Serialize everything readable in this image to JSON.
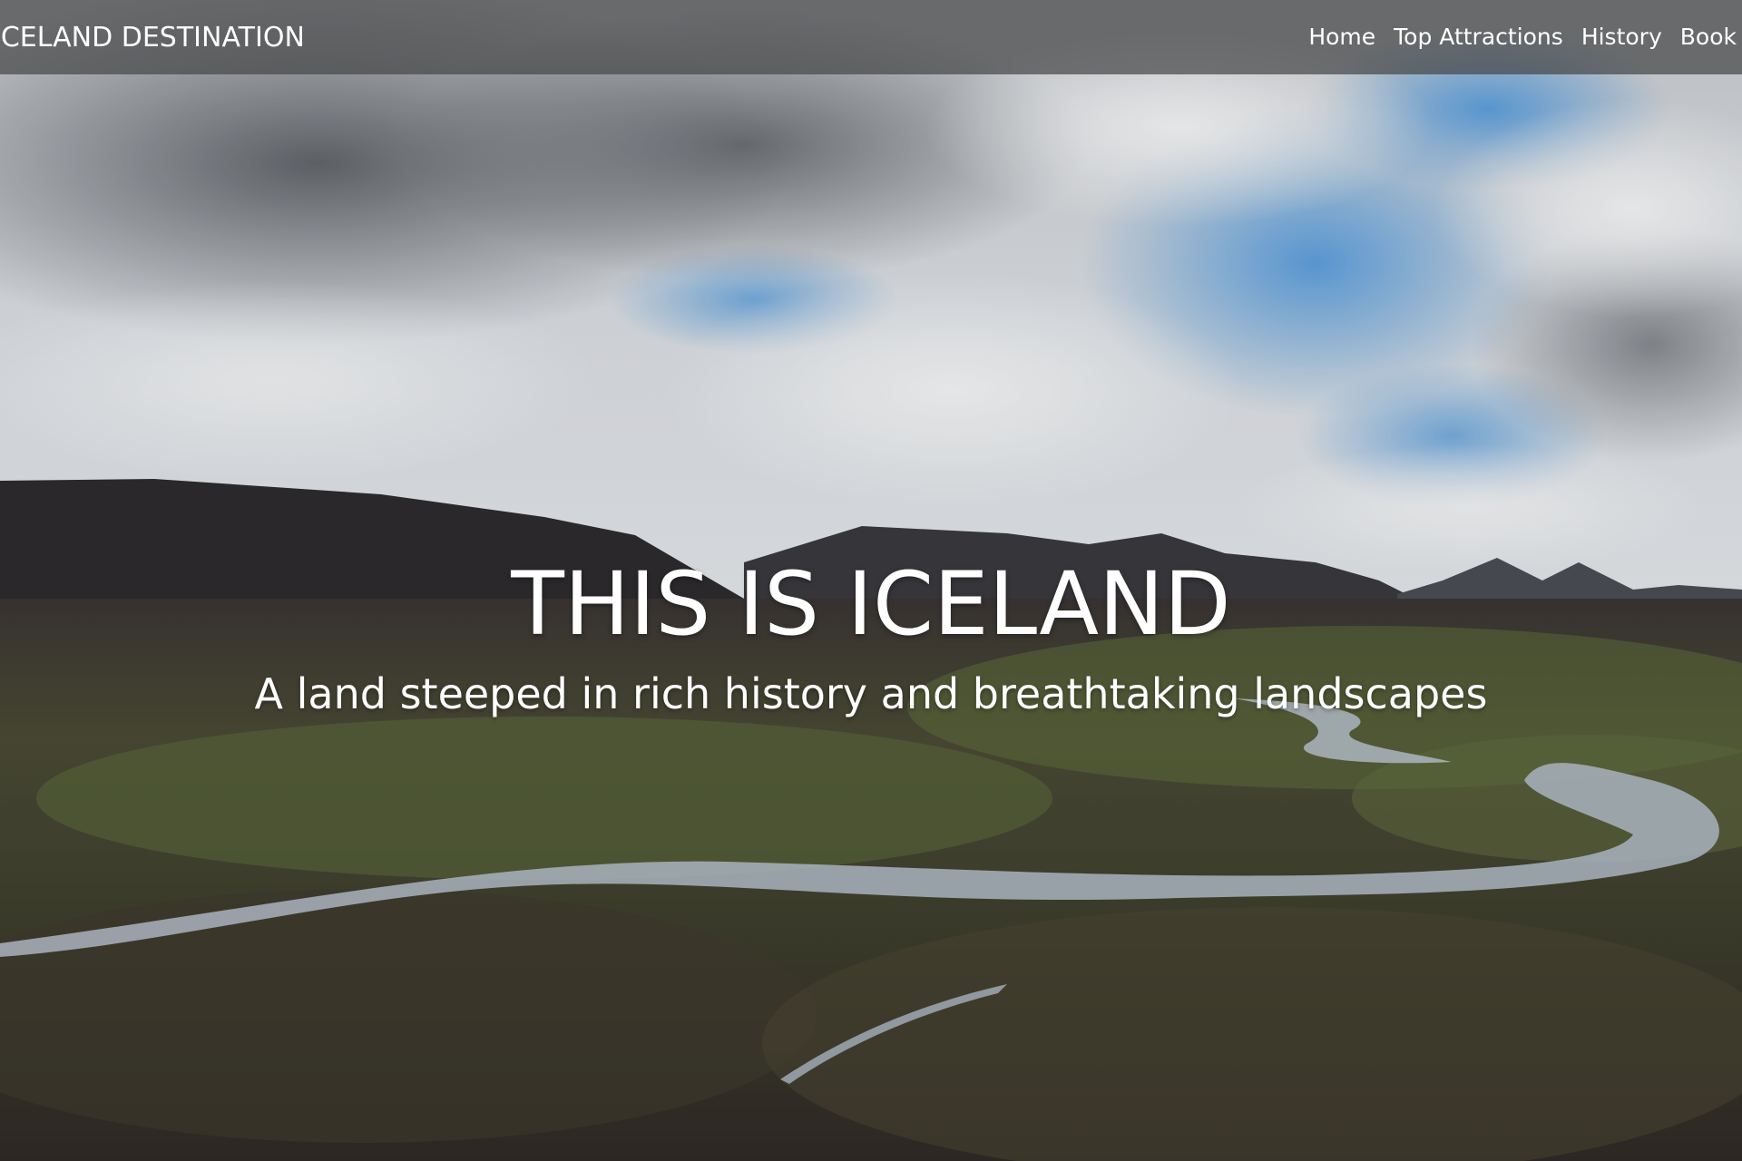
{
  "navbar": {
    "brand": "ICELAND DESTINATION",
    "links": [
      {
        "label": "Home"
      },
      {
        "label": "Top Attractions"
      },
      {
        "label": "History"
      },
      {
        "label": "Book"
      }
    ]
  },
  "hero": {
    "title": "THIS IS ICELAND",
    "subtitle": "A land steeped in rich history and breathtaking landscapes"
  },
  "colors": {
    "navbar_bg": "#46484a",
    "text": "#ffffff",
    "sky_blue": "#6aa6dd",
    "cloud": "#e6e8ea",
    "mountain": "#2c2a2c",
    "grass": "#4f5a33",
    "river": "#aeb8c2"
  }
}
